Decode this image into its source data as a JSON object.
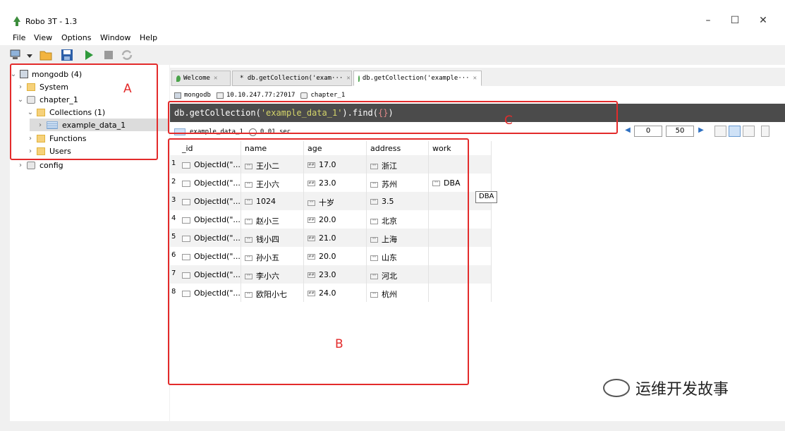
{
  "window": {
    "title": "Robo 3T - 1.3",
    "minimize": "–",
    "maximize": "☐",
    "close": "✕"
  },
  "menu": [
    "File",
    "View",
    "Options",
    "Window",
    "Help"
  ],
  "tree": {
    "root": "mongodb (4)",
    "system": "System",
    "db": "chapter_1",
    "collections": "Collections (1)",
    "collection_item": "example_data_1",
    "functions": "Functions",
    "users": "Users",
    "config": "config"
  },
  "tabs": [
    {
      "label": "Welcome"
    },
    {
      "label": "* db.getCollection('exam···"
    },
    {
      "label": "db.getCollection('example···"
    }
  ],
  "connection": {
    "server": "mongodb",
    "address": "10.10.247.77:27017",
    "database": "chapter_1"
  },
  "query": {
    "prefix": "db.getCollection(",
    "string": "'example_data_1'",
    "mid": ").find(",
    "braces": "{}",
    "suffix": ")"
  },
  "result": {
    "collection": "example_data_1",
    "time": "0.01 sec",
    "skip": "0",
    "limit": "50"
  },
  "columns": [
    "_id",
    "name",
    "age",
    "address",
    "work"
  ],
  "rows": [
    {
      "n": "1",
      "id": "ObjectId(\"...",
      "name": "王小二",
      "age": "17.0",
      "address": "浙江",
      "work": ""
    },
    {
      "n": "2",
      "id": "ObjectId(\"...",
      "name": "王小六",
      "age": "23.0",
      "address": "苏州",
      "work": "DBA"
    },
    {
      "n": "3",
      "id": "ObjectId(\"...",
      "name": "1024",
      "age": "十岁",
      "address": "3.5",
      "work": ""
    },
    {
      "n": "4",
      "id": "ObjectId(\"...",
      "name": "赵小三",
      "age": "20.0",
      "address": "北京",
      "work": ""
    },
    {
      "n": "5",
      "id": "ObjectId(\"...",
      "name": "钱小四",
      "age": "21.0",
      "address": "上海",
      "work": ""
    },
    {
      "n": "6",
      "id": "ObjectId(\"...",
      "name": "孙小五",
      "age": "20.0",
      "address": "山东",
      "work": ""
    },
    {
      "n": "7",
      "id": "ObjectId(\"...",
      "name": "李小六",
      "age": "23.0",
      "address": "河北",
      "work": ""
    },
    {
      "n": "8",
      "id": "ObjectId(\"...",
      "name": "欧阳小七",
      "age": "24.0",
      "address": "杭州",
      "work": ""
    }
  ],
  "tooltip": "DBA",
  "annotations": {
    "a": "A",
    "b": "B",
    "c": "C"
  },
  "watermark": "运维开发故事",
  "colors": {
    "annotation": "#e32b2b",
    "query_bg": "#4b4b4b"
  }
}
